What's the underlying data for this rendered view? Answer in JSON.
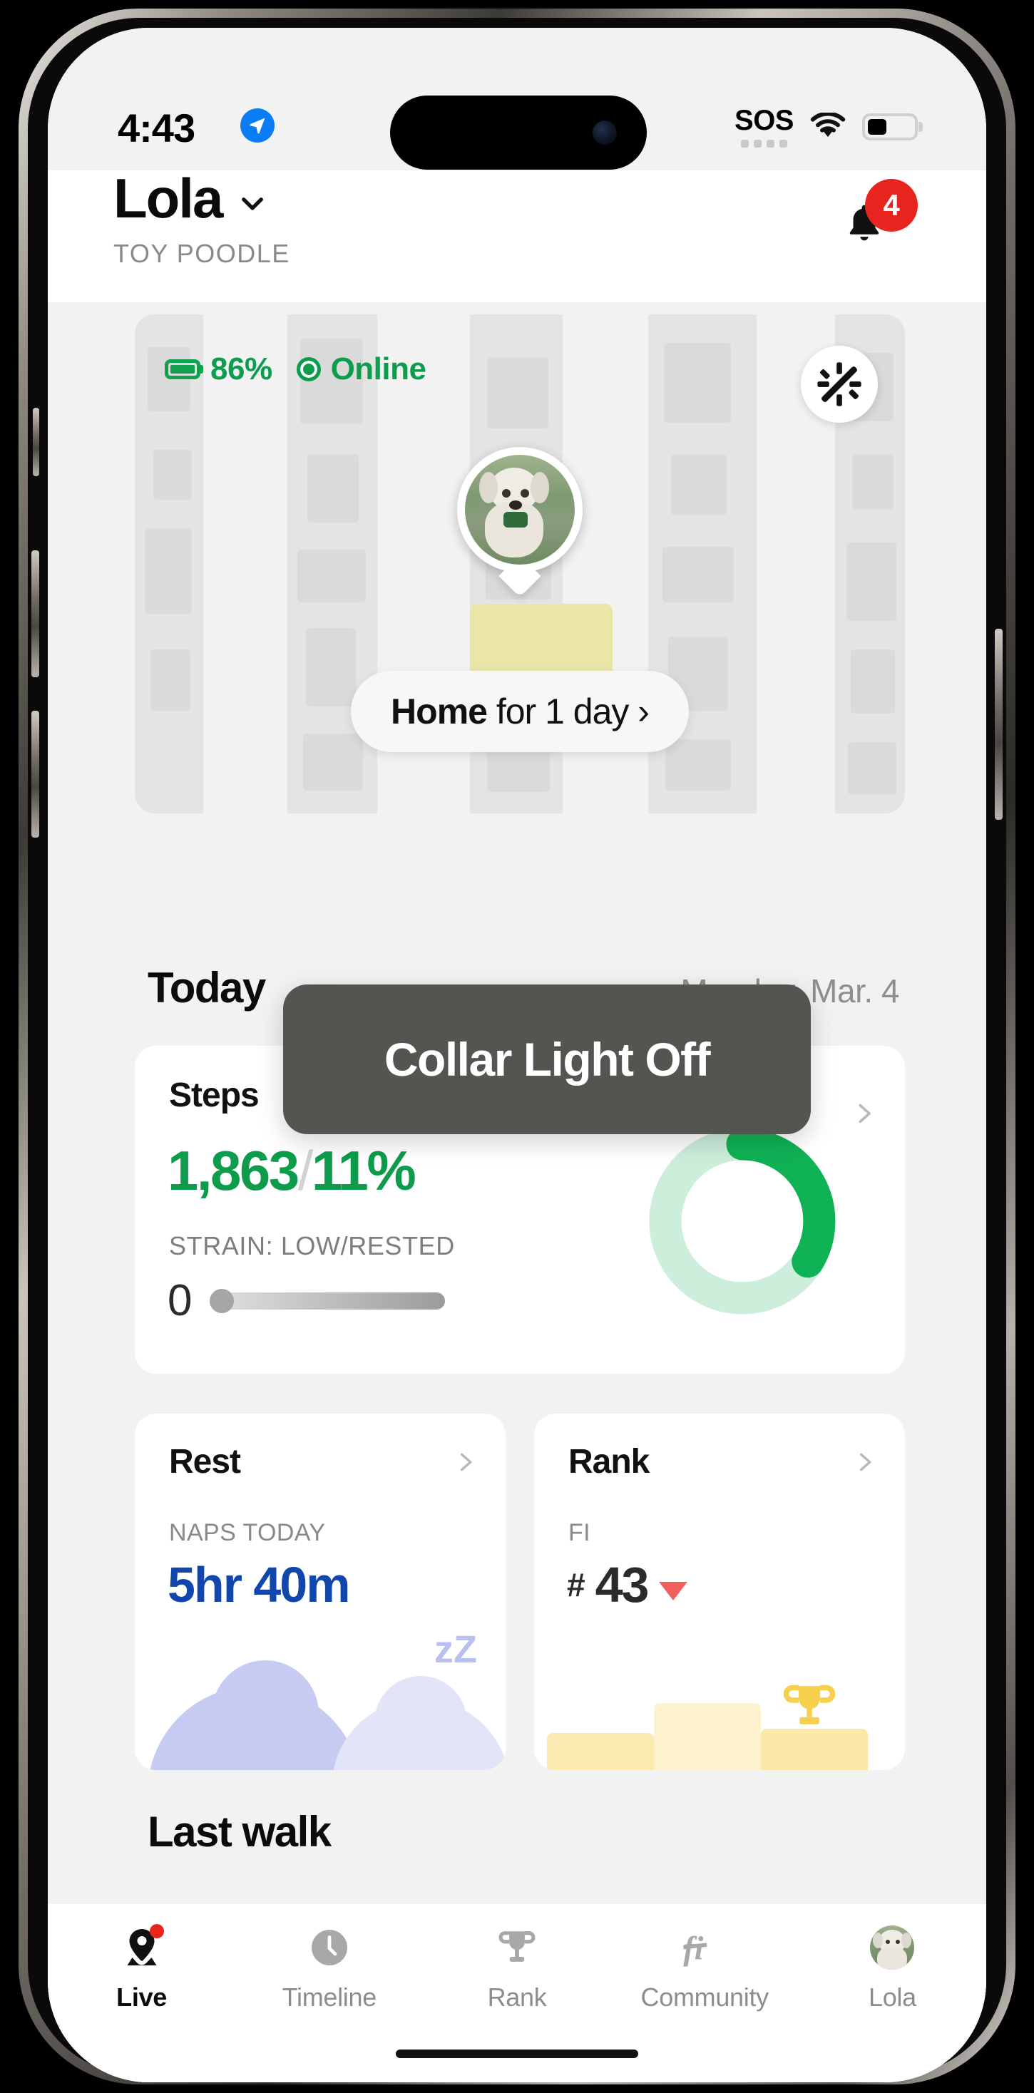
{
  "status_bar": {
    "time": "4:43",
    "location_icon": "location-arrow-icon",
    "sos_label": "SOS",
    "wifi_icon": "wifi-icon",
    "battery_icon": "battery-icon"
  },
  "header": {
    "pet_name": "Lola",
    "chevron_icon": "chevron-down-icon",
    "breed": "TOY POODLE",
    "bell_icon": "bell-icon",
    "notification_count": "4"
  },
  "map": {
    "battery_percent": "86%",
    "connection_status": "Online",
    "battery_icon": "battery-icon",
    "status_dot_icon": "online-dot-icon",
    "light_button_icon": "collar-light-off-icon",
    "pet_avatar_icon": "pet-avatar-icon",
    "location_name": "Home",
    "location_duration": " for 1 day ›"
  },
  "today": {
    "title": "Today",
    "date": "Monday, Mar. 4"
  },
  "steps_card": {
    "title": "Steps",
    "value": "1,863",
    "separator": "/",
    "percent": "11%",
    "strain_label": "STRAIN: LOW/RESTED",
    "strain_value": "0",
    "chevron_icon": "chevron-right-icon",
    "ring_icon": "progress-ring-icon"
  },
  "rest_card": {
    "title": "Rest",
    "subtitle": "NAPS TODAY",
    "value": "5hr 40m",
    "chevron_icon": "chevron-right-icon",
    "illustration_icon": "sleeping-clouds-icon",
    "zzz_label": "zZ"
  },
  "rank_card": {
    "title": "Rank",
    "subtitle": "FI",
    "hash": "#",
    "value": "43",
    "trend_icon": "trend-down-icon",
    "chevron_icon": "chevron-right-icon",
    "illustration_icon": "podium-trophy-icon"
  },
  "last_walk": {
    "title": "Last walk"
  },
  "toast": {
    "message": "Collar Light Off"
  },
  "tabs": [
    {
      "label": "Live",
      "icon": "location-pin-icon",
      "active": true,
      "badge": true
    },
    {
      "label": "Timeline",
      "icon": "clock-icon",
      "active": false,
      "badge": false
    },
    {
      "label": "Rank",
      "icon": "trophy-icon",
      "active": false,
      "badge": false
    },
    {
      "label": "Community",
      "icon": "fi-logo-icon",
      "active": false,
      "badge": false
    },
    {
      "label": "Lola",
      "icon": "pet-avatar-icon",
      "active": false,
      "badge": false
    }
  ],
  "colors": {
    "green": "#0d9c4c",
    "blue": "#1146ad",
    "red": "#e8241f",
    "coral": "#f0615e",
    "toast_bg": "#525550",
    "lavender": "#c6cbf2",
    "gold": "#f6d04d"
  }
}
